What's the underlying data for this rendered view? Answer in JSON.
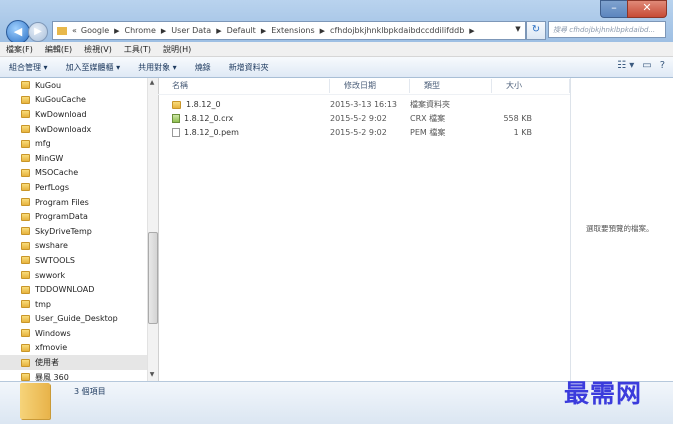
{
  "window": {
    "minimize": "–",
    "close": "✕",
    "back": "◀",
    "forward": "▶"
  },
  "address": {
    "prefix": "«",
    "crumbs": [
      "Google",
      "Chrome",
      "User Data",
      "Default",
      "Extensions",
      "cfhdojbkjhnklbpkdaibdccddilifddb"
    ],
    "refresh": "↻",
    "search_placeholder": "搜尋 cfhdojbkjhnklbpkdaibd..."
  },
  "menubar": [
    "檔案(F)",
    "編輯(E)",
    "檢視(V)",
    "工具(T)",
    "說明(H)"
  ],
  "toolbar": [
    "組合管理 ▾",
    "加入至媒體櫃 ▾",
    "共用對象 ▾",
    "燒錄",
    "新增資料夾"
  ],
  "toolbar_right": [
    "☷ ▾",
    "▭",
    "?"
  ],
  "nav_items": [
    "KuGou",
    "KuGouCache",
    "KwDownload",
    "KwDownloadx",
    "mfg",
    "MinGW",
    "MSOCache",
    "PerfLogs",
    "Program Files",
    "ProgramData",
    "SkyDriveTemp",
    "swshare",
    "SWTOOLS",
    "swwork",
    "TDDOWNLOAD",
    "tmp",
    "User_Guide_Desktop",
    "Windows",
    "xfmovie",
    "使用者",
    "暴風 360"
  ],
  "columns": [
    "名稱",
    "修改日期",
    "類型",
    "大小"
  ],
  "files": [
    {
      "name": "1.8.12_0",
      "date": "2015-3-13 16:13",
      "type": "檔案資料夾",
      "size": "",
      "icon": "folder"
    },
    {
      "name": "1.8.12_0.crx",
      "date": "2015-5-2 9:02",
      "type": "CRX 檔案",
      "size": "558 KB",
      "icon": "crx"
    },
    {
      "name": "1.8.12_0.pem",
      "date": "2015-5-2 9:02",
      "type": "PEM 檔案",
      "size": "1 KB",
      "icon": "file"
    }
  ],
  "preview_text": "選取要預覽的檔案。",
  "status": "3 個項目",
  "watermark": "最需网",
  "colors": {
    "watermark": "#3b3bdc",
    "titlebar": "#b9d3ee",
    "folder": "#e6b33e"
  }
}
